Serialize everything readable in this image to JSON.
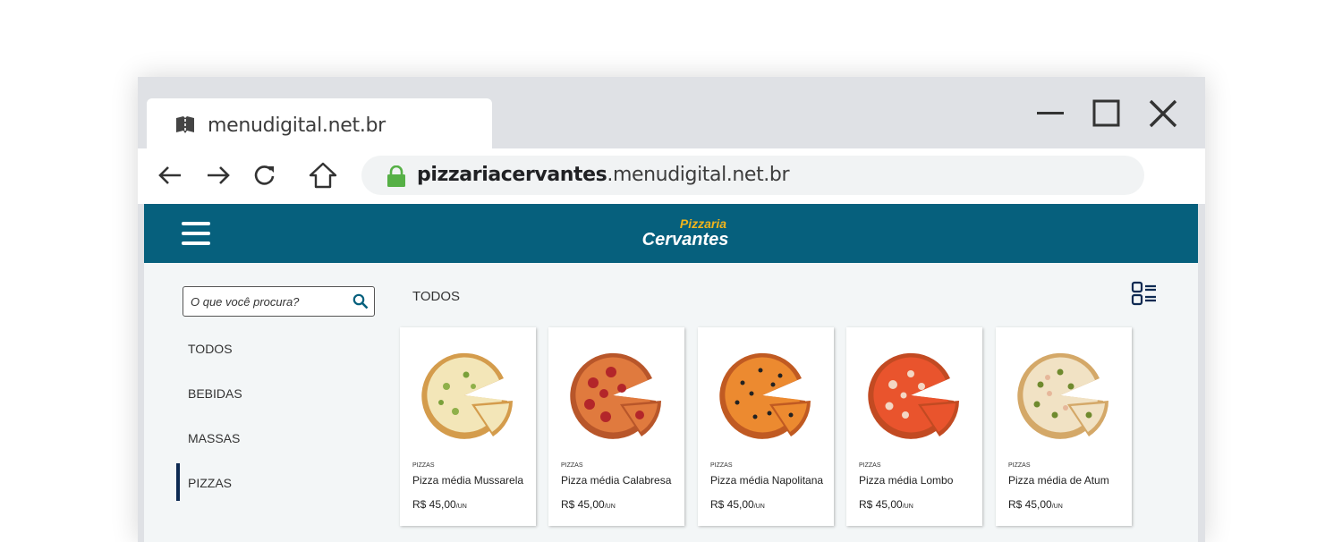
{
  "browser": {
    "tab_title": "menudigital.net.br",
    "url_bold": "pizzariacervantes",
    "url_rest": ".menudigital.net.br"
  },
  "header": {
    "logo_small": "Pizzaria",
    "logo_big": "Cervantes",
    "color": "#06607d",
    "accent": "#f2b51b"
  },
  "search": {
    "placeholder": "O que você procura?"
  },
  "categories": [
    {
      "label": "TODOS"
    },
    {
      "label": "BEBIDAS"
    },
    {
      "label": "MASSAS"
    },
    {
      "label": "PIZZAS",
      "active": true
    }
  ],
  "section_title": "TODOS",
  "products": [
    {
      "category": "PIZZAS",
      "name": "Pizza média Mussarela",
      "price": "R$ 45,00",
      "unit": "/UN"
    },
    {
      "category": "PIZZAS",
      "name": "Pizza média Calabresa",
      "price": "R$ 45,00",
      "unit": "/UN"
    },
    {
      "category": "PIZZAS",
      "name": "Pizza média Napolitana",
      "price": "R$ 45,00",
      "unit": "/UN"
    },
    {
      "category": "PIZZAS",
      "name": "Pizza média Lombo",
      "price": "R$ 45,00",
      "unit": "/UN"
    },
    {
      "category": "PIZZAS",
      "name": "Pizza média de Atum",
      "price": "R$ 45,00",
      "unit": "/UN"
    }
  ]
}
